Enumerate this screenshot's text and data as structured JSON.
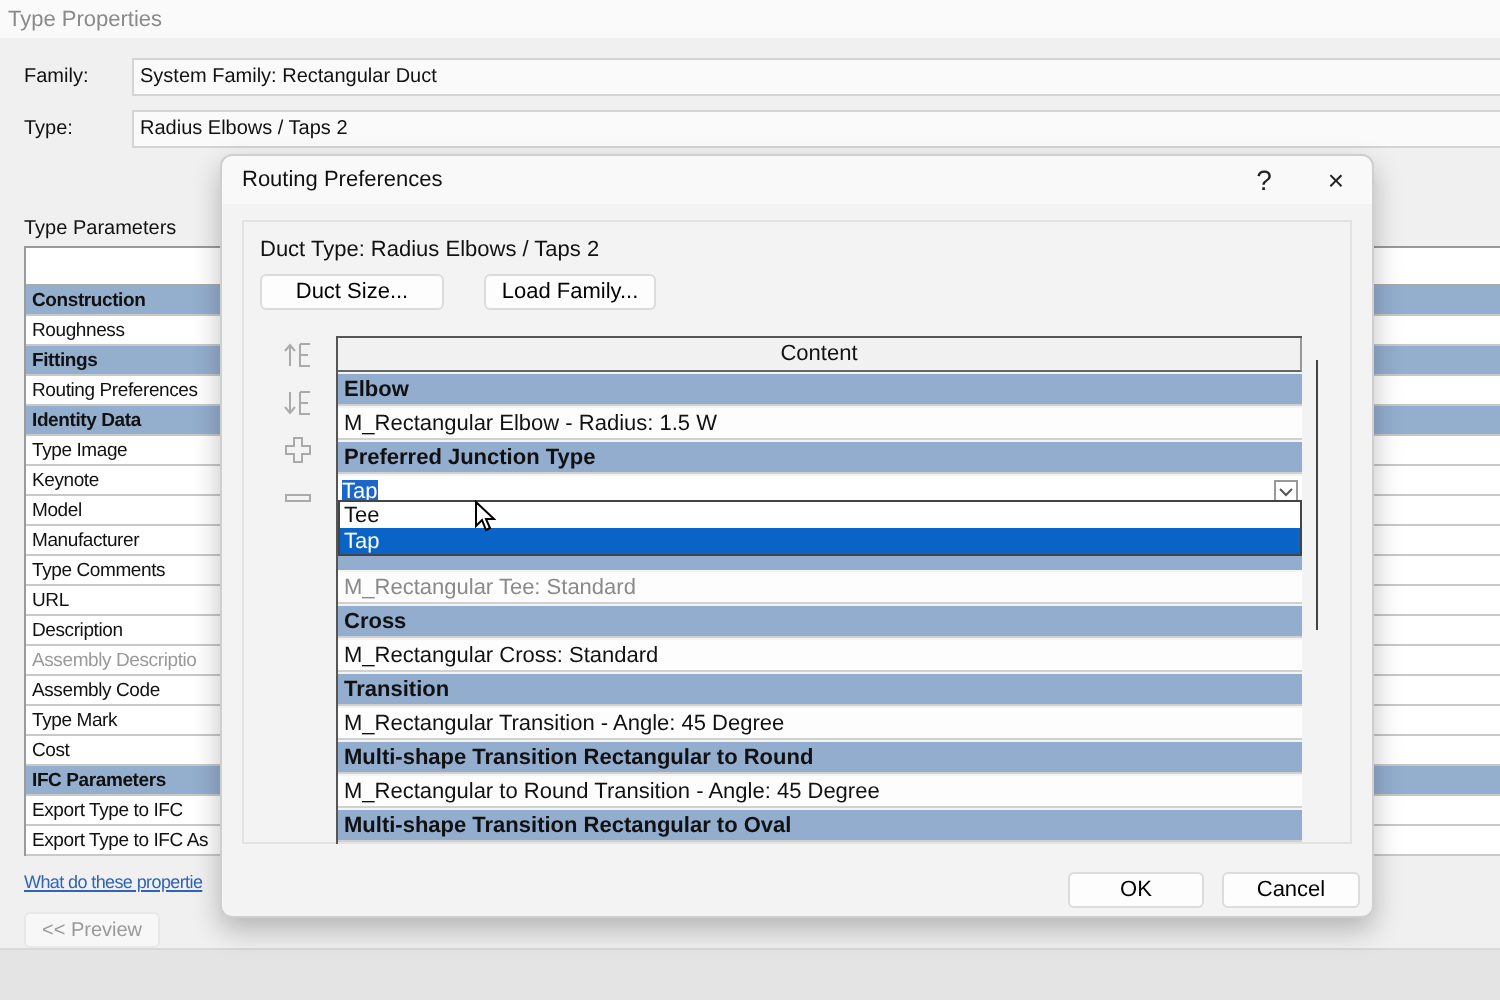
{
  "window": {
    "title": "Type Properties"
  },
  "family": {
    "label": "Family:",
    "value": "System Family: Rectangular Duct"
  },
  "type": {
    "label": "Type:",
    "value": "Radius Elbows / Taps 2"
  },
  "type_parameters": {
    "title": "Type Parameters",
    "rows": [
      {
        "kind": "group",
        "label": "Construction"
      },
      {
        "kind": "param",
        "label": "Roughness",
        "disabled": false
      },
      {
        "kind": "group",
        "label": "Fittings"
      },
      {
        "kind": "param",
        "label": "Routing Preferences",
        "disabled": false
      },
      {
        "kind": "group",
        "label": "Identity Data"
      },
      {
        "kind": "param",
        "label": "Type Image",
        "disabled": false
      },
      {
        "kind": "param",
        "label": "Keynote",
        "disabled": false
      },
      {
        "kind": "param",
        "label": "Model",
        "disabled": false
      },
      {
        "kind": "param",
        "label": "Manufacturer",
        "disabled": false
      },
      {
        "kind": "param",
        "label": "Type Comments",
        "disabled": false
      },
      {
        "kind": "param",
        "label": "URL",
        "disabled": false
      },
      {
        "kind": "param",
        "label": "Description",
        "disabled": false
      },
      {
        "kind": "param",
        "label": "Assembly Descriptio",
        "disabled": true
      },
      {
        "kind": "param",
        "label": "Assembly Code",
        "disabled": false
      },
      {
        "kind": "param",
        "label": "Type Mark",
        "disabled": false
      },
      {
        "kind": "param",
        "label": "Cost",
        "disabled": false
      },
      {
        "kind": "group",
        "label": "IFC Parameters"
      },
      {
        "kind": "param",
        "label": "Export Type to IFC",
        "disabled": false
      },
      {
        "kind": "param",
        "label": "Export Type to IFC As",
        "disabled": false
      }
    ]
  },
  "help_link": "What do these propertie",
  "preview_button": {
    "label": "<< Preview",
    "disabled": true
  },
  "dialog": {
    "title": "Routing Preferences",
    "help": "?",
    "close": "×",
    "duct_type": "Duct Type: Radius Elbows / Taps 2",
    "buttons": [
      "Duct Size...",
      "Load Family..."
    ],
    "table": {
      "column": "Content",
      "rows": [
        {
          "kind": "group",
          "label": "Elbow"
        },
        {
          "kind": "value",
          "label": "M_Rectangular Elbow - Radius: 1.5 W",
          "disabled": false
        },
        {
          "kind": "group",
          "label": "Preferred Junction Type"
        },
        {
          "kind": "combo",
          "value": "Tap",
          "expanded": true,
          "options": [
            {
              "label": "Tee",
              "selected": false
            },
            {
              "label": "Tap",
              "selected": true
            }
          ]
        },
        {
          "kind": "hidden"
        },
        {
          "kind": "value",
          "label": "M_Rectangular Tee: Standard",
          "disabled": true
        },
        {
          "kind": "group",
          "label": "Cross"
        },
        {
          "kind": "value",
          "label": "M_Rectangular Cross: Standard",
          "disabled": false
        },
        {
          "kind": "group",
          "label": "Transition"
        },
        {
          "kind": "value",
          "label": "M_Rectangular Transition - Angle: 45 Degree",
          "disabled": false
        },
        {
          "kind": "group",
          "label": "Multi-shape Transition Rectangular to Round"
        },
        {
          "kind": "value",
          "label": "M_Rectangular to Round Transition - Angle: 45 Degree",
          "disabled": false
        },
        {
          "kind": "group",
          "label": "Multi-shape Transition Rectangular to Oval"
        }
      ]
    },
    "footer_buttons": [
      "OK",
      "Cancel"
    ]
  }
}
